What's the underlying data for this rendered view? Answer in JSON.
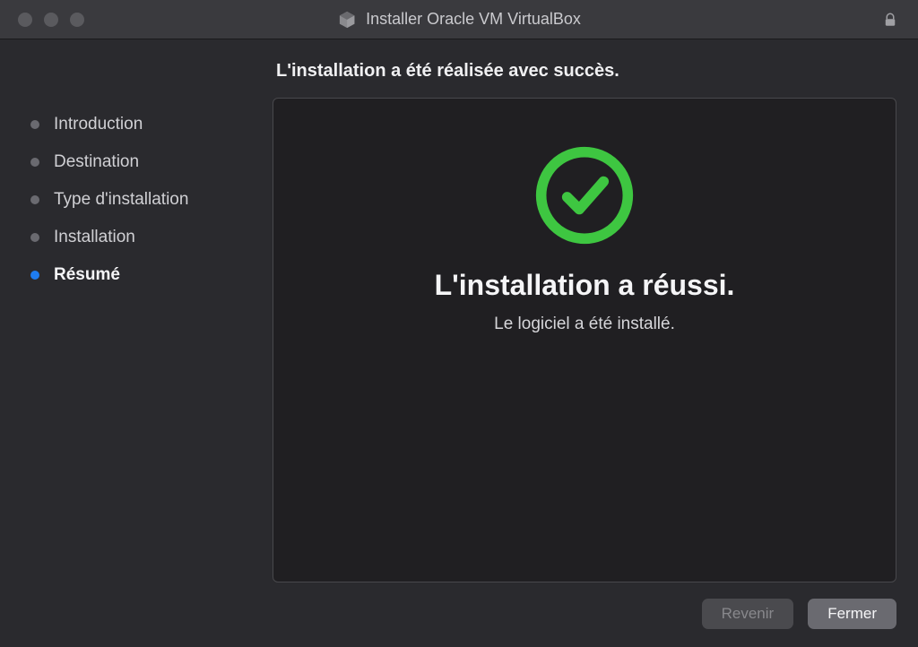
{
  "titlebar": {
    "title": "Installer Oracle VM VirtualBox"
  },
  "heading": "L'installation a été réalisée avec succès.",
  "sidebar": {
    "steps": [
      {
        "label": "Introduction",
        "active": false
      },
      {
        "label": "Destination",
        "active": false
      },
      {
        "label": "Type d'installation",
        "active": false
      },
      {
        "label": "Installation",
        "active": false
      },
      {
        "label": "Résumé",
        "active": true
      }
    ]
  },
  "panel": {
    "success_title": "L'installation a réussi.",
    "success_subtitle": "Le logiciel a été installé."
  },
  "footer": {
    "back_label": "Revenir",
    "close_label": "Fermer"
  },
  "colors": {
    "accent_green": "#3ec641",
    "accent_blue": "#1e7cf0"
  }
}
